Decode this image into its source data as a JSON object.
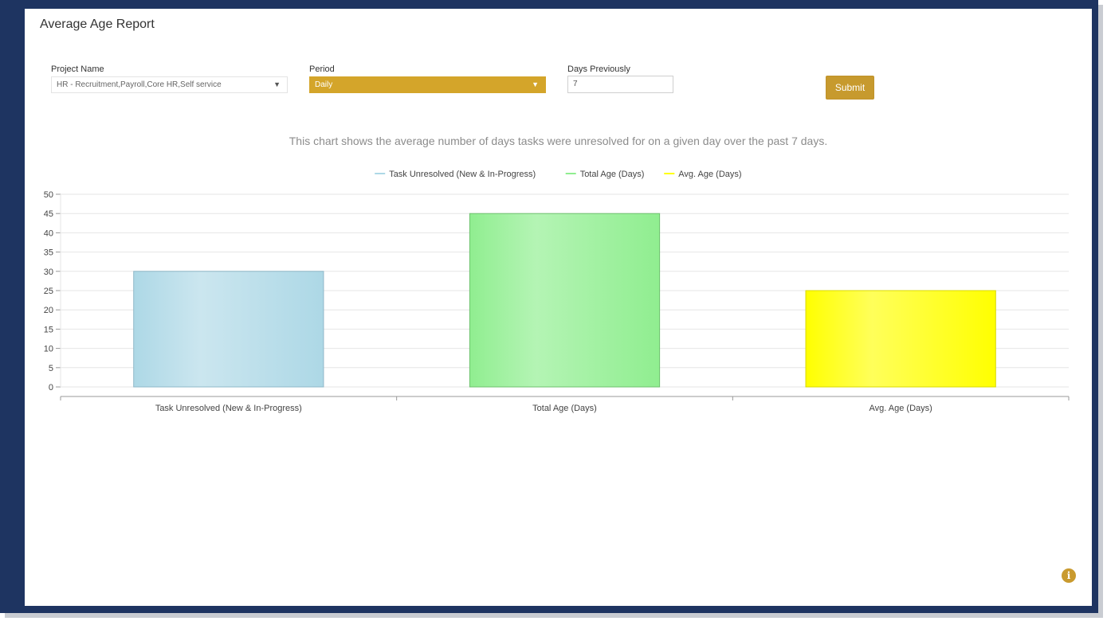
{
  "page": {
    "title": "Average Age Report"
  },
  "filters": {
    "project_label": "Project Name",
    "project_value": "HR - Recruitment,Payroll,Core HR,Self service",
    "period_label": "Period",
    "period_value": "Daily",
    "days_label": "Days Previously",
    "days_value": "7",
    "submit_label": "Submit"
  },
  "caption": "This chart shows the average number of days tasks were unresolved for on a given day over the past 7 days.",
  "colors": {
    "accent": "#d4a52a",
    "frame": "#1e3461"
  },
  "icons": {
    "dropdown": "chevron-down-icon",
    "info": "info-icon"
  },
  "chart_data": {
    "type": "bar",
    "categories": [
      "Task Unresolved (New & In-Progress)",
      "Total Age (Days)",
      "Avg. Age (Days)"
    ],
    "values": [
      30,
      45,
      25
    ],
    "colors": [
      "#add8e6",
      "#90ee90",
      "#ffff00"
    ],
    "legend": [
      "Task Unresolved (New & In-Progress)",
      "Total Age (Days)",
      "Avg. Age (Days)"
    ],
    "legend_position": "top",
    "yticks": [
      0,
      5,
      10,
      15,
      20,
      25,
      30,
      35,
      40,
      45,
      50
    ],
    "ylim": [
      0,
      50
    ],
    "grid": true
  }
}
